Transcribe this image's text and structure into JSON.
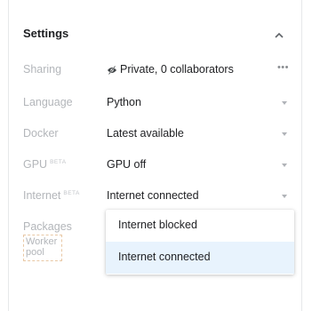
{
  "settings": {
    "title": "Settings",
    "rows": [
      {
        "label": "Sharing",
        "value": "Private, 0 collaborators",
        "more": "•••"
      },
      {
        "label": "Language",
        "value": "Python"
      },
      {
        "label": "Docker",
        "value": "Latest available"
      },
      {
        "label": "GPU",
        "badge": "BETA",
        "value": "GPU off"
      },
      {
        "label": "Internet",
        "badge": "BETA",
        "value": "Internet connected"
      },
      {
        "label": "Packages"
      },
      {
        "label": "Worker pool"
      }
    ]
  },
  "dropdown": {
    "options": [
      "Internet blocked",
      "Internet connected"
    ],
    "selected": "Internet connected"
  },
  "colors": {
    "selected_bg": "#e8f3fd",
    "highlight_border": "#e8c7a4"
  },
  "icons": {
    "sharing": "eye-off-icon",
    "collapse": "chevron-up-icon",
    "more": "more-horizontal-icon",
    "dropdown": "caret-down-icon"
  }
}
